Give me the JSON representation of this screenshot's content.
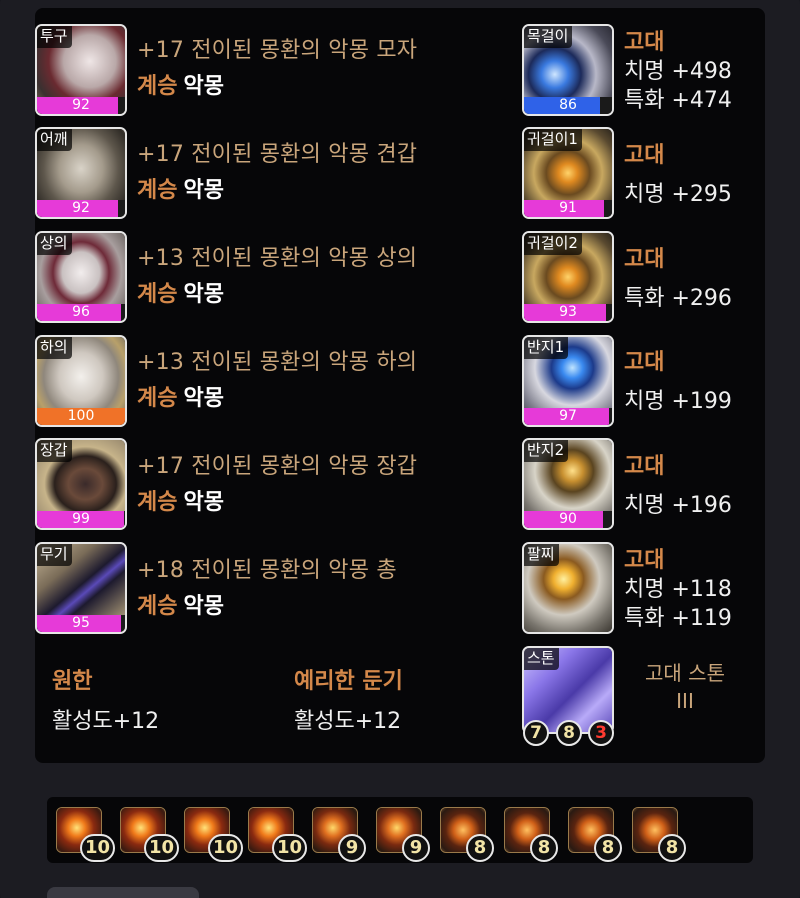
{
  "equipment": [
    {
      "slot": "투구",
      "quality": "92",
      "quality_color": "#e63ad8",
      "quality_pct": 92,
      "name": "+17 전이된 몽환의 악몽 모자",
      "grade": "계승",
      "set": "악몽"
    },
    {
      "slot": "어깨",
      "quality": "92",
      "quality_color": "#e63ad8",
      "quality_pct": 92,
      "name": "+17 전이된 몽환의 악몽 견갑",
      "grade": "계승",
      "set": "악몽"
    },
    {
      "slot": "상의",
      "quality": "96",
      "quality_color": "#e63ad8",
      "quality_pct": 96,
      "name": "+13 전이된 몽환의 악몽 상의",
      "grade": "계승",
      "set": "악몽"
    },
    {
      "slot": "하의",
      "quality": "100",
      "quality_color": "#f07228",
      "quality_pct": 100,
      "name": "+13 전이된 몽환의 악몽 하의",
      "grade": "계승",
      "set": "악몽"
    },
    {
      "slot": "장갑",
      "quality": "99",
      "quality_color": "#e63ad8",
      "quality_pct": 99,
      "name": "+17 전이된 몽환의 악몽 장갑",
      "grade": "계승",
      "set": "악몽"
    },
    {
      "slot": "무기",
      "quality": "95",
      "quality_color": "#e63ad8",
      "quality_pct": 95,
      "name": "+18 전이된 몽환의 악몽 총",
      "grade": "계승",
      "set": "악몽"
    }
  ],
  "accessories": [
    {
      "slot": "목걸이",
      "quality": "86",
      "quality_color": "#2f62e8",
      "quality_pct": 86,
      "grade": "고대",
      "stats": [
        "치명 +498",
        "특화 +474"
      ]
    },
    {
      "slot": "귀걸이1",
      "quality": "91",
      "quality_color": "#e63ad8",
      "quality_pct": 91,
      "grade": "고대",
      "stats": [
        "치명 +295"
      ]
    },
    {
      "slot": "귀걸이2",
      "quality": "93",
      "quality_color": "#e63ad8",
      "quality_pct": 93,
      "grade": "고대",
      "stats": [
        "특화 +296"
      ]
    },
    {
      "slot": "반지1",
      "quality": "97",
      "quality_color": "#e63ad8",
      "quality_pct": 97,
      "grade": "고대",
      "stats": [
        "치명 +199"
      ]
    },
    {
      "slot": "반지2",
      "quality": "90",
      "quality_color": "#e63ad8",
      "quality_pct": 90,
      "grade": "고대",
      "stats": [
        "치명 +196"
      ]
    },
    {
      "slot": "팔찌",
      "grade": "고대",
      "stats": [
        "치명 +118",
        "특화 +119"
      ]
    }
  ],
  "engravings": [
    {
      "name": "원한",
      "value": "활성도+12"
    },
    {
      "name": "예리한 둔기",
      "value": "활성도+12"
    }
  ],
  "ability_stone": {
    "slot": "스톤",
    "title_line1": "고대 스톤",
    "title_line2": "III",
    "levels": [
      "7",
      "8",
      "3"
    ]
  },
  "gems": [
    {
      "level": "10",
      "icon": "damage-gem-icon"
    },
    {
      "level": "10",
      "icon": "damage-gem-icon"
    },
    {
      "level": "10",
      "icon": "damage-gem-icon"
    },
    {
      "level": "10",
      "icon": "damage-gem-icon"
    },
    {
      "level": "9",
      "icon": "damage-gem-icon"
    },
    {
      "level": "9",
      "icon": "damage-gem-icon"
    },
    {
      "level": "8",
      "icon": "cooldown-gem-icon"
    },
    {
      "level": "8",
      "icon": "cooldown-gem-icon"
    },
    {
      "level": "8",
      "icon": "cooldown-gem-icon"
    },
    {
      "level": "8",
      "icon": "cooldown-gem-icon"
    }
  ],
  "colors": {
    "name_gold": "#c9a57b",
    "grade_orange": "#d4884a",
    "quality_pink": "#e63ad8",
    "quality_orange": "#f07228",
    "quality_blue": "#2f62e8",
    "stone_red_level": "#ff3b30"
  }
}
